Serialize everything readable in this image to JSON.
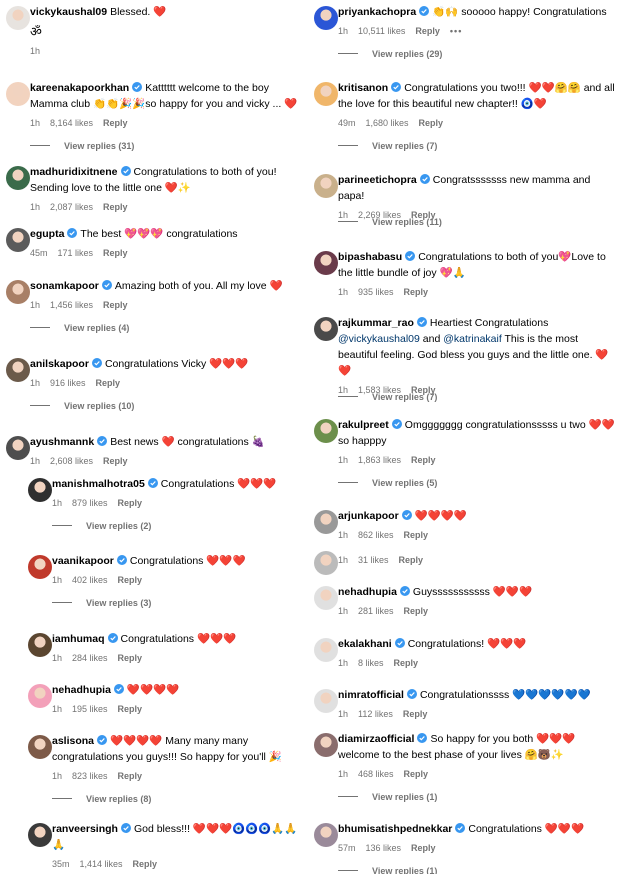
{
  "left": [
    {
      "user": "vickykaushal09",
      "text": "Blessed. ❤️",
      "line2": "ॐ",
      "time": "1h",
      "likes": "",
      "reply": "",
      "vr": ""
    },
    {
      "user": "kareenakapoorkhan",
      "text": "Katttttt welcome to the boy Mamma club 👏👏🎉🎉so happy for you and vicky ... ❤️",
      "time": "1h",
      "likes": "8,164 likes",
      "reply": "Reply",
      "vr": "View replies (31)"
    },
    {
      "user": "madhuridixitnene",
      "text": "Congratulations to both of you! Sending love to the little one ❤️✨",
      "time": "1h",
      "likes": "2,087 likes",
      "reply": "Reply",
      "vr": ""
    },
    {
      "user": "egupta",
      "text": "The best 💖💖💖 congratulations",
      "time": "45m",
      "likes": "171 likes",
      "reply": "Reply",
      "vr": ""
    },
    {
      "user": "sonamkapoor",
      "text": "Amazing both of you. All my love ❤️",
      "time": "1h",
      "likes": "1,456 likes",
      "reply": "Reply",
      "vr": "View replies (4)"
    },
    {
      "user": "anilskapoor",
      "text": "Congratulations Vicky ❤️❤️❤️",
      "time": "1h",
      "likes": "916 likes",
      "reply": "Reply",
      "vr": "View replies (10)"
    },
    {
      "user": "ayushmannk",
      "text": "Best news ❤️ congratulations 🍇",
      "time": "1h",
      "likes": "2,608 likes",
      "reply": "Reply",
      "vr": ""
    },
    {
      "user": "manishmalhotra05",
      "text": "Congratulations ❤️❤️❤️",
      "time": "1h",
      "likes": "879 likes",
      "reply": "Reply",
      "vr": "View replies (2)"
    },
    {
      "user": "vaanikapoor",
      "text": "Congratulations ❤️❤️❤️",
      "time": "1h",
      "likes": "402 likes",
      "reply": "Reply",
      "vr": "View replies (3)"
    },
    {
      "user": "iamhumaq",
      "text": "Congratulations ❤️❤️❤️",
      "time": "1h",
      "likes": "284 likes",
      "reply": "Reply",
      "vr": ""
    },
    {
      "user": "nehadhupia",
      "text": "❤️❤️❤️❤️",
      "time": "1h",
      "likes": "195 likes",
      "reply": "Reply",
      "vr": ""
    },
    {
      "user": "aslisona",
      "text": "❤️❤️❤️❤️ Many many many congratulations you guys!!! So happy for you'll 🎉",
      "time": "1h",
      "likes": "823 likes",
      "reply": "Reply",
      "vr": "View replies (8)"
    },
    {
      "user": "ranveersingh",
      "text": "God bless!!! ❤️❤️❤️🧿🧿🧿🙏🙏🙏",
      "time": "35m",
      "likes": "1,414 likes",
      "reply": "Reply",
      "vr": ""
    }
  ],
  "right": [
    {
      "user": "priyankachopra",
      "text": "👏🙌 sooooo happy! Congratulations",
      "time": "1h",
      "likes": "10,511 likes",
      "reply": "Reply",
      "more": "•••",
      "vr": "View replies (29)"
    },
    {
      "user": "kritisanon",
      "text": "Congratulations you two!!! ❤️❤️🤗🤗 and all the love for this beautiful new chapter!! 🧿❤️",
      "time": "49m",
      "likes": "1,680 likes",
      "reply": "Reply",
      "vr": "View replies (7)"
    },
    {
      "user": "parineetichopra",
      "text": "Congratsssssss new mamma and papa!",
      "time": "1h",
      "likes": "2,269 likes",
      "reply": "Reply",
      "vr": "View replies (11)"
    },
    {
      "user": "bipashabasu",
      "text": "Congratulations to both of you💖Love to the little bundle of joy 💖🙏",
      "time": "1h",
      "likes": "935 likes",
      "reply": "Reply",
      "vr": ""
    },
    {
      "user": "rajkummar_rao",
      "text": "Heartiest Congratulations",
      "mention1": "@vickykaushal09",
      "text_mid": " and ",
      "mention2": "@katrinakaif",
      "text2": " This is the most beautiful feeling. God bless you guys and the little one. ❤️❤️",
      "time": "1h",
      "likes": "1,583 likes",
      "reply": "Reply",
      "vr": "View replies (7)"
    },
    {
      "user": "rakulpreet",
      "text": "Omggggggg congratulationsssss u two ❤️❤️ so happpy",
      "time": "1h",
      "likes": "1,863 likes",
      "reply": "Reply",
      "vr": "View replies (5)"
    },
    {
      "user": "arjunkapoor",
      "text": "❤️❤️❤️❤️",
      "time": "1h",
      "likes": "862 likes",
      "reply": "Reply",
      "vr": ""
    },
    {
      "user": "",
      "text": "",
      "time": "1h",
      "likes": "31 likes",
      "reply": "Reply",
      "vr": ""
    },
    {
      "user": "nehadhupia",
      "text": "Guysssssssssss ❤️❤️❤️",
      "time": "1h",
      "likes": "281 likes",
      "reply": "Reply",
      "vr": ""
    },
    {
      "user": "ekalakhani",
      "text": "Congratulations! ❤️❤️❤️",
      "time": "1h",
      "likes": "8 likes",
      "reply": "Reply",
      "vr": ""
    },
    {
      "user": "nimratofficial",
      "text": "Congratulationssss 💙💙💙💙💙💙",
      "time": "1h",
      "likes": "112 likes",
      "reply": "Reply",
      "vr": ""
    },
    {
      "user": "diamirzaofficial",
      "text": "So happy for you both ❤️❤️❤️ welcome to the best phase of your lives 🤗🐻✨",
      "time": "1h",
      "likes": "468 likes",
      "reply": "Reply",
      "vr": "View replies (1)"
    },
    {
      "user": "bhumisatishpednekkar",
      "text": "Congratulations ❤️❤️❤️",
      "time": "57m",
      "likes": "136 likes",
      "reply": "Reply",
      "vr": "View replies (1)"
    }
  ],
  "colors": {
    "verified": "#3897f0",
    "meta": "#737373",
    "mention": "#00376b",
    "heart": "#ee2c56"
  },
  "avatars": {
    "left": [
      "#e7e3df",
      "#f2d3bf",
      "#3a6b4a",
      "#5b5b5b",
      "#a87f66",
      "#6b5a4a",
      "#4e4e4e",
      "#2f2f2f",
      "#c0392b",
      "#5b4630",
      "#f3a0b9",
      "#7d5a48",
      "#3a3a3a"
    ],
    "right": [
      "#2b56d6",
      "#f0b66a",
      "#c9b08b",
      "#6a3b4a",
      "#4a4a4a",
      "#6c8f4b",
      "#999",
      "#bbb",
      "#e0e0e0",
      "#e0e0e0",
      "#e0e0e0",
      "#8a6d6d",
      "#9a8a9a"
    ]
  }
}
